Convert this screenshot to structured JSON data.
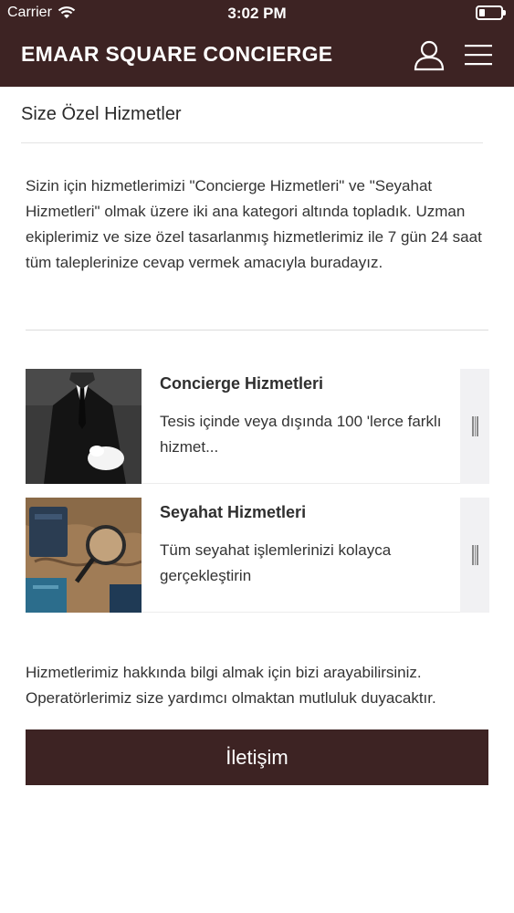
{
  "status_bar": {
    "carrier": "Carrier",
    "time": "3:02 PM"
  },
  "header": {
    "title": "EMAAR SQUARE CONCIERGE",
    "icons": [
      "user-icon",
      "menu-icon"
    ]
  },
  "page": {
    "section_title": "Size Özel Hizmetler",
    "intro": "Sizin için hizmetlerimizi \"Concierge Hizmetleri\" ve \"Seyahat Hizmetleri\" olmak üzere iki ana kategori altında topladık. Uzman ekiplerimiz ve size özel tasarlanmış hizmetlerimiz ile 7 gün 24 saat tüm taleplerinize cevap vermek amacıyla buradayız."
  },
  "services": [
    {
      "title": "Concierge Hizmetleri",
      "description": "Tesis içinde veya dışında 100 'lerce farklı hizmet...",
      "image": "butler-in-suit"
    },
    {
      "title": "Seyahat Hizmetleri",
      "description": "Tüm seyahat işlemlerinizi kolayca gerçekleştirin",
      "image": "travel-map-passport"
    }
  ],
  "contact": {
    "text": "Hizmetlerimiz hakkında bilgi almak için bizi arayabilirsiniz. Operatörlerimiz size yardımcı olmaktan mutluluk duyacaktır.",
    "button_label": "İletişim"
  },
  "colors": {
    "brand": "#3d2323",
    "background": "#ffffff",
    "text": "#333333"
  }
}
